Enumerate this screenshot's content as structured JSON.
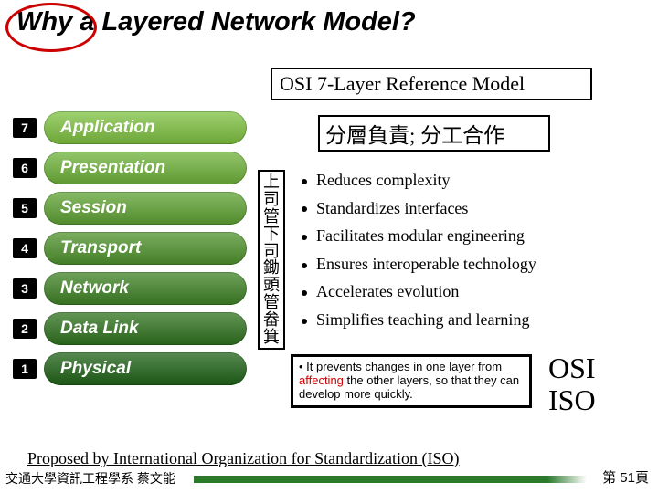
{
  "title": "Why a Layered Network Model?",
  "subtitle": "OSI 7-Layer Reference Model",
  "cn_heading": "分層負責; 分工合作",
  "cn_vertical": "上司管下司鋤頭管畚箕",
  "layers": [
    {
      "num": "7",
      "label": "Application",
      "color": "#7fc241"
    },
    {
      "num": "6",
      "label": "Presentation",
      "color": "#6fb33a"
    },
    {
      "num": "5",
      "label": "Session",
      "color": "#5fa333"
    },
    {
      "num": "4",
      "label": "Transport",
      "color": "#4f932c"
    },
    {
      "num": "3",
      "label": "Network",
      "color": "#3f8325"
    },
    {
      "num": "2",
      "label": "Data Link",
      "color": "#2f731e"
    },
    {
      "num": "1",
      "label": "Physical",
      "color": "#1f6317"
    }
  ],
  "benefits": [
    "Reduces complexity",
    "Standardizes interfaces",
    "Facilitates modular engineering",
    "Ensures interoperable technology",
    "Accelerates evolution",
    "Simplifies teaching and learning"
  ],
  "note": {
    "prefix": "• It prevents changes in one layer from ",
    "affecting": "affecting",
    "suffix": " the other layers, so that they can develop more quickly."
  },
  "osi": "OSI",
  "iso": "ISO",
  "footer_proposed": "Proposed by International Organization for Standardization (ISO)",
  "footer_cn": "交通大學資訊工程學系 蔡文能",
  "footer_page": "第 51頁"
}
